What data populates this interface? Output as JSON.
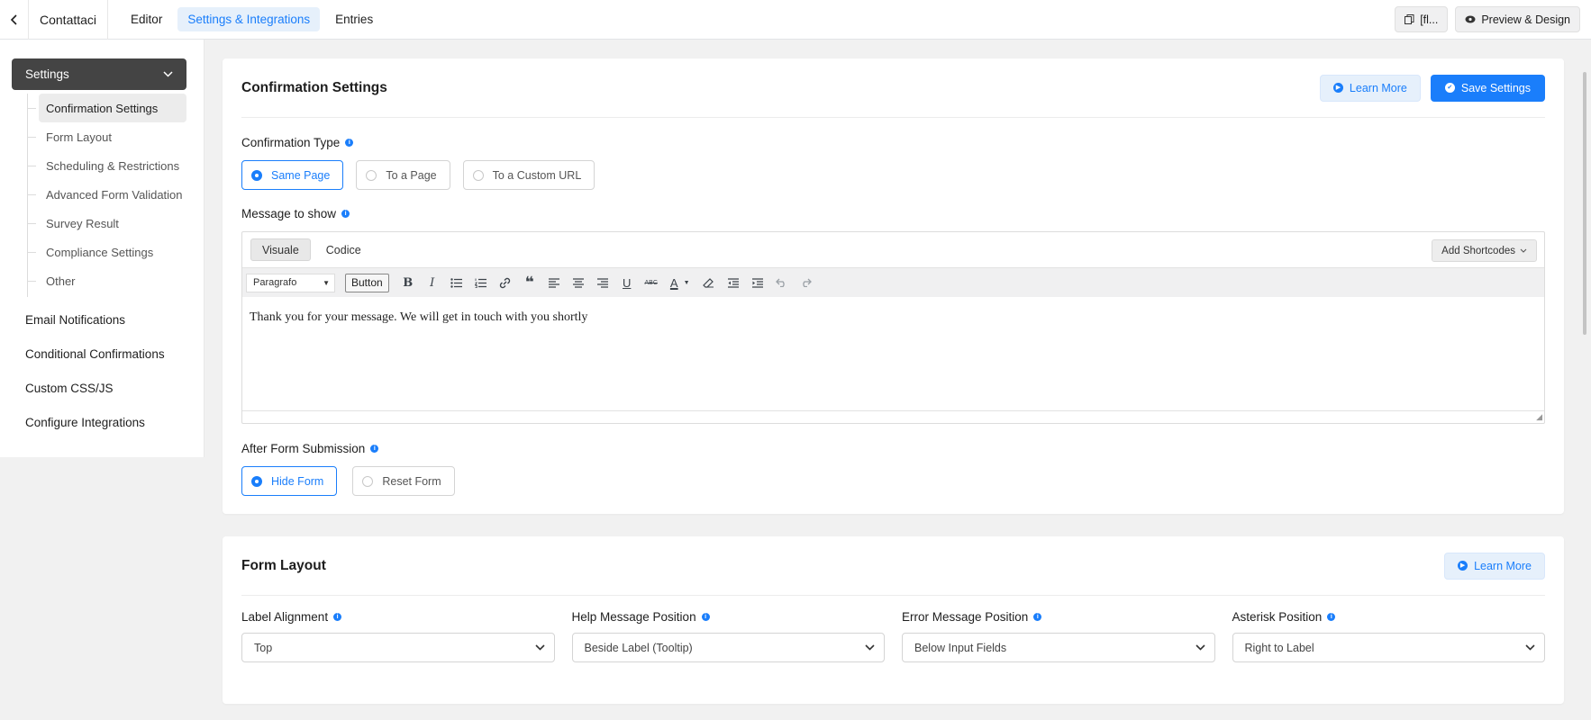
{
  "topbar": {
    "form_name": "Contattaci",
    "tabs": [
      {
        "label": "Editor",
        "active": false
      },
      {
        "label": "Settings & Integrations",
        "active": true
      },
      {
        "label": "Entries",
        "active": false
      }
    ],
    "shortcode_label": "[fl...",
    "preview_label": "Preview & Design"
  },
  "sidebar": {
    "header": "Settings",
    "sub_items": [
      {
        "label": "Confirmation Settings",
        "active": true
      },
      {
        "label": "Form Layout"
      },
      {
        "label": "Scheduling & Restrictions"
      },
      {
        "label": "Advanced Form Validation"
      },
      {
        "label": "Survey Result"
      },
      {
        "label": "Compliance Settings"
      },
      {
        "label": "Other"
      }
    ],
    "items": [
      {
        "label": "Email Notifications"
      },
      {
        "label": "Conditional Confirmations"
      },
      {
        "label": "Custom CSS/JS"
      },
      {
        "label": "Configure Integrations"
      }
    ]
  },
  "confirmation": {
    "title": "Confirmation Settings",
    "learn_more": "Learn More",
    "save": "Save Settings",
    "type_label": "Confirmation Type",
    "type_options": [
      {
        "label": "Same Page",
        "selected": true
      },
      {
        "label": "To a Page",
        "selected": false
      },
      {
        "label": "To a Custom URL",
        "selected": false
      }
    ],
    "message_label": "Message to show",
    "editor": {
      "tab_visual": "Visuale",
      "tab_code": "Codice",
      "add_shortcodes": "Add Shortcodes",
      "format": "Paragrafo",
      "button_label": "Button",
      "content": "Thank you for your message. We will get in touch with you shortly"
    },
    "after_label": "After Form Submission",
    "after_options": [
      {
        "label": "Hide Form",
        "selected": true
      },
      {
        "label": "Reset Form",
        "selected": false
      }
    ]
  },
  "form_layout": {
    "title": "Form Layout",
    "learn_more": "Learn More",
    "fields": [
      {
        "label": "Label Alignment",
        "value": "Top"
      },
      {
        "label": "Help Message Position",
        "value": "Beside Label (Tooltip)"
      },
      {
        "label": "Error Message Position",
        "value": "Below Input Fields"
      },
      {
        "label": "Asterisk Position",
        "value": "Right to Label"
      }
    ]
  },
  "colors": {
    "accent": "#1a7efb",
    "sidebar_header": "#444444",
    "page_bg": "#f1f1f1"
  }
}
